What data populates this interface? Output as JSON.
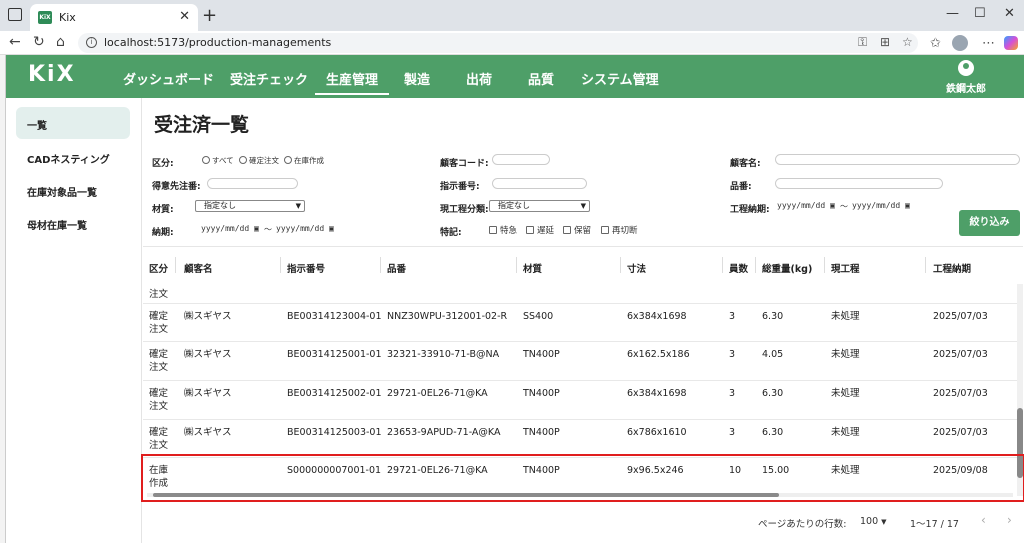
{
  "browser": {
    "tab_title": "Kix",
    "favicon_text": "KiX",
    "url": "localhost:5173/production-managements"
  },
  "app": {
    "logo": "KiX",
    "menu": [
      "ダッシュボード",
      "受注チェック",
      "生産管理",
      "製造",
      "出荷",
      "品質",
      "システム管理"
    ],
    "active_menu": "生産管理",
    "user_name": "鉄鋼太郎"
  },
  "sidebar": {
    "items": [
      "一覧",
      "CADネスティング",
      "在庫対象品一覧",
      "母材在庫一覧"
    ],
    "active": "一覧"
  },
  "page_title": "受注済一覧",
  "filters": {
    "kubun_label": "区分:",
    "kubun_options": [
      "すべて",
      "確定注文",
      "在庫作成"
    ],
    "tokui_label": "得意先注番:",
    "zaishitsu_label": "材質:",
    "zaishitsu_value": "指定なし",
    "nouki_label": "納期:",
    "date_placeholder": "yyyy/mm/dd",
    "range_sep": "～",
    "kokyaku_code_label": "顧客コード:",
    "shiji_label": "指示番号:",
    "genkotei_label": "現工程分類:",
    "genkotei_value": "指定なし",
    "tokki_label": "特記:",
    "tokki_options": [
      "特急",
      "遅延",
      "保留",
      "再切断"
    ],
    "kokyaku_mei_label": "顧客名:",
    "hinban_label": "品番:",
    "koutei_nouki_label": "工程納期:",
    "submit_label": "絞り込み"
  },
  "table": {
    "columns": [
      "区分",
      "顧客名",
      "指示番号",
      "品番",
      "材質",
      "寸法",
      "員数",
      "総重量(kg)",
      "現工程",
      "工程納期"
    ],
    "partial_row_kubun": "注文",
    "rows": [
      {
        "kubun": [
          "確定",
          "注文"
        ],
        "customer": "㈱スギヤス",
        "order_no": "BE00314123004-01",
        "part_no": "NNZ30WPU-312001-02-R",
        "material": "SS400",
        "size": "6x384x1698",
        "qty": "3",
        "weight": "6.30",
        "process": "未処理",
        "due": "2025/07/03"
      },
      {
        "kubun": [
          "確定",
          "注文"
        ],
        "customer": "㈱スギヤス",
        "order_no": "BE00314125001-01",
        "part_no": "32321-33910-71-B@NA",
        "material": "TN400P",
        "size": "6x162.5x186",
        "qty": "3",
        "weight": "4.05",
        "process": "未処理",
        "due": "2025/07/03"
      },
      {
        "kubun": [
          "確定",
          "注文"
        ],
        "customer": "㈱スギヤス",
        "order_no": "BE00314125002-01",
        "part_no": "29721-0EL26-71@KA",
        "material": "TN400P",
        "size": "6x384x1698",
        "qty": "3",
        "weight": "6.30",
        "process": "未処理",
        "due": "2025/07/03"
      },
      {
        "kubun": [
          "確定",
          "注文"
        ],
        "customer": "㈱スギヤス",
        "order_no": "BE00314125003-01",
        "part_no": "23653-9APUD-71-A@KA",
        "material": "TN400P",
        "size": "6x786x1610",
        "qty": "3",
        "weight": "6.30",
        "process": "未処理",
        "due": "2025/07/03"
      },
      {
        "kubun": [
          "在庫",
          "作成"
        ],
        "customer": "",
        "order_no": "S000000007001-01",
        "part_no": "29721-0EL26-71@KA",
        "material": "TN400P",
        "size": "9x96.5x246",
        "qty": "10",
        "weight": "15.00",
        "process": "未処理",
        "due": "2025/09/08"
      }
    ]
  },
  "pagination": {
    "rows_per_page_label": "ページあたりの行数:",
    "rows_per_page": "100",
    "range": "1～17 / 17"
  },
  "colors": {
    "header_green": "#4e9f68",
    "highlight_red": "#e01e1e",
    "sidebar_active": "#e3efed"
  }
}
